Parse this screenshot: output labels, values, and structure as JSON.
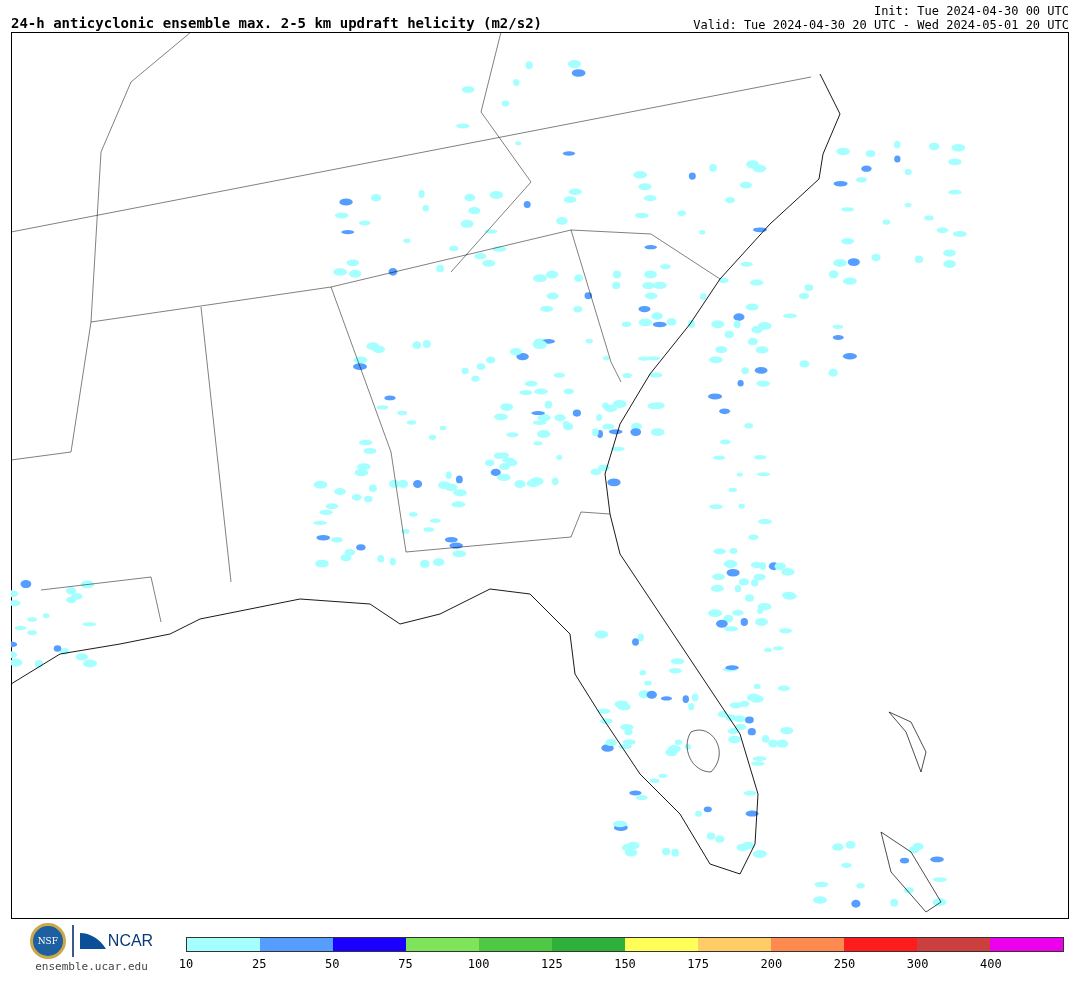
{
  "title": "24-h anticyclonic ensemble max. 2-5 km updraft helicity (m2/s2)",
  "init": "Init: Tue 2024-04-30 00 UTC",
  "valid": "Valid: Tue 2024-04-30 20 UTC - Wed 2024-05-01 20 UTC",
  "logos": {
    "nsf": "NSF",
    "ncar": "NCAR",
    "site": "ensemble.ucar.edu"
  },
  "colorbar": {
    "bins": [
      {
        "color": "#a6ffff"
      },
      {
        "color": "#559dff"
      },
      {
        "color": "#1900ff"
      },
      {
        "color": "#7ee55a"
      },
      {
        "color": "#4fc945"
      },
      {
        "color": "#2eb03a"
      },
      {
        "color": "#ffff5a"
      },
      {
        "color": "#ffcc66"
      },
      {
        "color": "#ff8a50"
      },
      {
        "color": "#ff1c1c"
      },
      {
        "color": "#cc3f3f"
      },
      {
        "color": "#ec00ec"
      }
    ],
    "ticks": [
      "10",
      "25",
      "50",
      "75",
      "100",
      "125",
      "150",
      "175",
      "200",
      "250",
      "300",
      "400"
    ]
  }
}
